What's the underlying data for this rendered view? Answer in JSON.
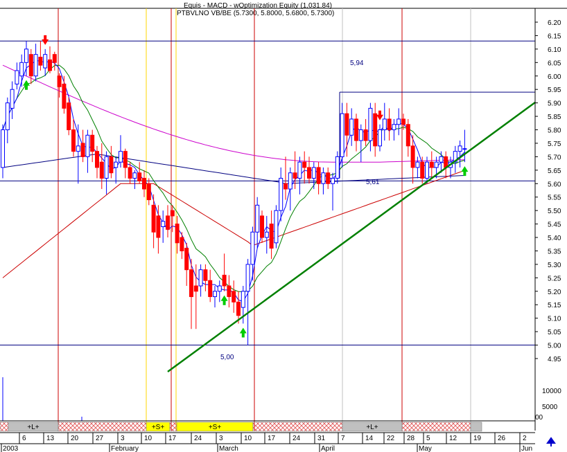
{
  "chart_data": {
    "type": "candlestick",
    "header": {
      "line1": "Equis - MACD - wOptimization Equity (1,031.84)",
      "line2": "PTBVLNO VB/BE (5.7300, 5.8000, 5.6800, 5.7300)"
    },
    "colors": {
      "up": "#0000ff",
      "down": "#ff0000",
      "ma_short": "#0000ff",
      "ma_medium": "#008000",
      "ma_long_red": "#cc0000",
      "ma_long_navy": "#000080",
      "ma_200": "#cc00cc",
      "trendline": "#008000",
      "hlines": "#000080",
      "vline_red": "#cc0000",
      "vline_yellow": "#ffd700",
      "vline_gray": "#c0c0c0",
      "arrow_up": "#00cc00",
      "arrow_down": "#ff0000"
    },
    "y_axis": {
      "ylim": [
        4.82,
        6.27
      ],
      "ticks": [
        6.2,
        6.15,
        6.1,
        6.05,
        6.0,
        5.95,
        5.9,
        5.85,
        5.8,
        5.75,
        5.7,
        5.65,
        5.6,
        5.55,
        5.5,
        5.45,
        5.4,
        5.35,
        5.3,
        5.25,
        5.2,
        5.15,
        5.1,
        5.05,
        5.0,
        4.95
      ],
      "tick_labels": [
        "6.20",
        "6.15",
        "6.10",
        "6.05",
        "6.00",
        "5.95",
        "5.90",
        "5.85",
        "5.80",
        "5.75",
        "5.70",
        "5.65",
        "5.60",
        "5.55",
        "5.50",
        "5.45",
        "5.40",
        "5.35",
        "5.30",
        "5.25",
        "5.20",
        "5.15",
        "5.10",
        "5.05",
        "5.00",
        "4.95"
      ]
    },
    "volume_axis": {
      "labels": [
        "10000",
        "5000",
        "00"
      ]
    },
    "x_axis": {
      "day_labels": [
        "6",
        "13",
        "20",
        "27",
        "3",
        "10",
        "17",
        "24",
        "3",
        "10",
        "17",
        "24",
        "31",
        "7",
        "14",
        "22",
        "28",
        "5",
        "12",
        "19",
        "26",
        "2"
      ],
      "month_labels": [
        "2003",
        "February",
        "March",
        "April",
        "May",
        "Jun"
      ]
    },
    "horizontal_levels": [
      {
        "value": 6.13
      },
      {
        "value": 5.94
      },
      {
        "value": 5.61
      },
      {
        "value": 5.0
      }
    ],
    "annotations": [
      "5,94",
      "5,61",
      "5,00"
    ],
    "signal_bar_labels": [
      "+L+",
      "+S+",
      "+S+",
      "+L+"
    ],
    "candles": [
      {
        "o": 5.66,
        "h": 5.82,
        "l": 5.62,
        "c": 5.8
      },
      {
        "o": 5.8,
        "h": 5.92,
        "l": 5.75,
        "c": 5.9
      },
      {
        "o": 5.88,
        "h": 5.98,
        "l": 5.84,
        "c": 5.95
      },
      {
        "o": 5.97,
        "h": 6.05,
        "l": 5.95,
        "c": 6.02
      },
      {
        "o": 6.0,
        "h": 6.08,
        "l": 5.96,
        "c": 6.05
      },
      {
        "o": 6.05,
        "h": 6.13,
        "l": 6.0,
        "c": 6.1
      },
      {
        "o": 6.08,
        "h": 6.1,
        "l": 5.97,
        "c": 6.0
      },
      {
        "o": 6.0,
        "h": 6.12,
        "l": 5.98,
        "c": 6.08
      },
      {
        "o": 6.07,
        "h": 6.13,
        "l": 6.02,
        "c": 6.04
      },
      {
        "o": 6.03,
        "h": 6.1,
        "l": 6.0,
        "c": 6.08
      },
      {
        "o": 6.06,
        "h": 6.11,
        "l": 6.01,
        "c": 6.02
      },
      {
        "o": 6.08,
        "h": 6.09,
        "l": 6.02,
        "c": 6.05
      },
      {
        "o": 6.0,
        "h": 6.01,
        "l": 5.92,
        "c": 5.96
      },
      {
        "o": 5.97,
        "h": 6.0,
        "l": 5.86,
        "c": 5.88
      },
      {
        "o": 5.9,
        "h": 5.92,
        "l": 5.78,
        "c": 5.8
      },
      {
        "o": 5.8,
        "h": 5.84,
        "l": 5.7,
        "c": 5.72
      },
      {
        "o": 5.72,
        "h": 5.82,
        "l": 5.6,
        "c": 5.74
      },
      {
        "o": 5.75,
        "h": 5.8,
        "l": 5.68,
        "c": 5.7
      },
      {
        "o": 5.7,
        "h": 5.8,
        "l": 5.64,
        "c": 5.78
      },
      {
        "o": 5.78,
        "h": 5.8,
        "l": 5.68,
        "c": 5.72
      },
      {
        "o": 5.72,
        "h": 5.74,
        "l": 5.62,
        "c": 5.66
      },
      {
        "o": 5.68,
        "h": 5.75,
        "l": 5.58,
        "c": 5.62
      },
      {
        "o": 5.62,
        "h": 5.72,
        "l": 5.56,
        "c": 5.7
      },
      {
        "o": 5.7,
        "h": 5.74,
        "l": 5.62,
        "c": 5.64
      },
      {
        "o": 5.66,
        "h": 5.7,
        "l": 5.6,
        "c": 5.68
      },
      {
        "o": 5.68,
        "h": 5.78,
        "l": 5.66,
        "c": 5.72
      },
      {
        "o": 5.72,
        "h": 5.73,
        "l": 5.62,
        "c": 5.66
      },
      {
        "o": 5.66,
        "h": 5.68,
        "l": 5.6,
        "c": 5.62
      },
      {
        "o": 5.62,
        "h": 5.65,
        "l": 5.58,
        "c": 5.64
      },
      {
        "o": 5.64,
        "h": 5.68,
        "l": 5.6,
        "c": 5.61
      },
      {
        "o": 5.62,
        "h": 5.65,
        "l": 5.55,
        "c": 5.58
      },
      {
        "o": 5.6,
        "h": 5.62,
        "l": 5.52,
        "c": 5.54
      },
      {
        "o": 5.52,
        "h": 5.56,
        "l": 5.36,
        "c": 5.42
      },
      {
        "o": 5.48,
        "h": 5.52,
        "l": 5.34,
        "c": 5.4
      },
      {
        "o": 5.44,
        "h": 5.5,
        "l": 5.38,
        "c": 5.46
      },
      {
        "o": 5.48,
        "h": 5.52,
        "l": 5.4,
        "c": 5.43
      },
      {
        "o": 5.5,
        "h": 5.52,
        "l": 5.42,
        "c": 5.48
      },
      {
        "o": 5.45,
        "h": 5.48,
        "l": 5.34,
        "c": 5.38
      },
      {
        "o": 5.4,
        "h": 5.42,
        "l": 5.32,
        "c": 5.35
      },
      {
        "o": 5.36,
        "h": 5.38,
        "l": 5.22,
        "c": 5.28
      },
      {
        "o": 5.28,
        "h": 5.32,
        "l": 5.06,
        "c": 5.18
      },
      {
        "o": 5.22,
        "h": 5.3,
        "l": 5.06,
        "c": 5.2
      },
      {
        "o": 5.22,
        "h": 5.3,
        "l": 5.18,
        "c": 5.28
      },
      {
        "o": 5.28,
        "h": 5.3,
        "l": 5.2,
        "c": 5.24
      },
      {
        "o": 5.24,
        "h": 5.28,
        "l": 5.16,
        "c": 5.18
      },
      {
        "o": 5.18,
        "h": 5.22,
        "l": 5.14,
        "c": 5.2
      },
      {
        "o": 5.2,
        "h": 5.24,
        "l": 5.16,
        "c": 5.22
      },
      {
        "o": 5.26,
        "h": 5.34,
        "l": 5.2,
        "c": 5.22
      },
      {
        "o": 5.22,
        "h": 5.26,
        "l": 5.14,
        "c": 5.18
      },
      {
        "o": 5.2,
        "h": 5.24,
        "l": 5.12,
        "c": 5.16
      },
      {
        "o": 5.16,
        "h": 5.2,
        "l": 5.08,
        "c": 5.11
      },
      {
        "o": 5.14,
        "h": 5.22,
        "l": 5.08,
        "c": 5.2
      },
      {
        "o": 5.2,
        "h": 5.32,
        "l": 5.0,
        "c": 5.3
      },
      {
        "o": 5.3,
        "h": 5.44,
        "l": 5.24,
        "c": 5.42
      },
      {
        "o": 5.42,
        "h": 5.55,
        "l": 5.36,
        "c": 5.52
      },
      {
        "o": 5.48,
        "h": 5.5,
        "l": 5.38,
        "c": 5.4
      },
      {
        "o": 5.4,
        "h": 5.48,
        "l": 5.34,
        "c": 5.42
      },
      {
        "o": 5.45,
        "h": 5.5,
        "l": 5.32,
        "c": 5.36
      },
      {
        "o": 5.38,
        "h": 5.52,
        "l": 5.36,
        "c": 5.5
      },
      {
        "o": 5.5,
        "h": 5.66,
        "l": 5.46,
        "c": 5.62
      },
      {
        "o": 5.6,
        "h": 5.7,
        "l": 5.54,
        "c": 5.58
      },
      {
        "o": 5.58,
        "h": 5.66,
        "l": 5.5,
        "c": 5.64
      },
      {
        "o": 5.64,
        "h": 5.72,
        "l": 5.58,
        "c": 5.62
      },
      {
        "o": 5.62,
        "h": 5.7,
        "l": 5.56,
        "c": 5.68
      },
      {
        "o": 5.68,
        "h": 5.72,
        "l": 5.6,
        "c": 5.66
      },
      {
        "o": 5.66,
        "h": 5.7,
        "l": 5.6,
        "c": 5.62
      },
      {
        "o": 5.62,
        "h": 5.68,
        "l": 5.58,
        "c": 5.66
      },
      {
        "o": 5.66,
        "h": 5.68,
        "l": 5.56,
        "c": 5.6
      },
      {
        "o": 5.6,
        "h": 5.66,
        "l": 5.56,
        "c": 5.64
      },
      {
        "o": 5.64,
        "h": 5.66,
        "l": 5.58,
        "c": 5.6
      },
      {
        "o": 5.6,
        "h": 5.64,
        "l": 5.5,
        "c": 5.62
      },
      {
        "o": 5.62,
        "h": 5.72,
        "l": 5.6,
        "c": 5.7
      },
      {
        "o": 5.7,
        "h": 5.9,
        "l": 5.66,
        "c": 5.86
      },
      {
        "o": 5.86,
        "h": 5.9,
        "l": 5.7,
        "c": 5.78
      },
      {
        "o": 5.78,
        "h": 5.88,
        "l": 5.74,
        "c": 5.84
      },
      {
        "o": 5.84,
        "h": 5.86,
        "l": 5.72,
        "c": 5.76
      },
      {
        "o": 5.76,
        "h": 5.82,
        "l": 5.68,
        "c": 5.8
      },
      {
        "o": 5.8,
        "h": 5.84,
        "l": 5.74,
        "c": 5.76
      },
      {
        "o": 5.76,
        "h": 5.9,
        "l": 5.72,
        "c": 5.88
      },
      {
        "o": 5.86,
        "h": 5.9,
        "l": 5.7,
        "c": 5.74
      },
      {
        "o": 5.74,
        "h": 5.82,
        "l": 5.72,
        "c": 5.8
      },
      {
        "o": 5.8,
        "h": 5.9,
        "l": 5.76,
        "c": 5.84
      },
      {
        "o": 5.84,
        "h": 5.88,
        "l": 5.76,
        "c": 5.8
      },
      {
        "o": 5.8,
        "h": 5.84,
        "l": 5.76,
        "c": 5.82
      },
      {
        "o": 5.82,
        "h": 5.88,
        "l": 5.78,
        "c": 5.84
      },
      {
        "o": 5.84,
        "h": 5.86,
        "l": 5.8,
        "c": 5.82
      },
      {
        "o": 5.82,
        "h": 5.84,
        "l": 5.7,
        "c": 5.74
      },
      {
        "o": 5.74,
        "h": 5.78,
        "l": 5.6,
        "c": 5.66
      },
      {
        "o": 5.66,
        "h": 5.7,
        "l": 5.62,
        "c": 5.68
      },
      {
        "o": 5.68,
        "h": 5.7,
        "l": 5.6,
        "c": 5.62
      },
      {
        "o": 5.62,
        "h": 5.7,
        "l": 5.6,
        "c": 5.68
      },
      {
        "o": 5.68,
        "h": 5.72,
        "l": 5.62,
        "c": 5.66
      },
      {
        "o": 5.66,
        "h": 5.7,
        "l": 5.62,
        "c": 5.68
      },
      {
        "o": 5.68,
        "h": 5.72,
        "l": 5.64,
        "c": 5.7
      },
      {
        "o": 5.7,
        "h": 5.72,
        "l": 5.62,
        "c": 5.66
      },
      {
        "o": 5.66,
        "h": 5.7,
        "l": 5.62,
        "c": 5.68
      },
      {
        "o": 5.68,
        "h": 5.74,
        "l": 5.64,
        "c": 5.72
      },
      {
        "o": 5.72,
        "h": 5.76,
        "l": 5.66,
        "c": 5.74
      },
      {
        "o": 5.73,
        "h": 5.8,
        "l": 5.68,
        "c": 5.73
      }
    ],
    "markers": [
      {
        "dir": "down",
        "candle": 9
      },
      {
        "dir": "up",
        "candle": 5
      },
      {
        "dir": "up",
        "candle": 47
      },
      {
        "dir": "up",
        "candle": 51
      },
      {
        "dir": "down",
        "candle": 80
      },
      {
        "dir": "up",
        "candle": 98
      }
    ]
  }
}
